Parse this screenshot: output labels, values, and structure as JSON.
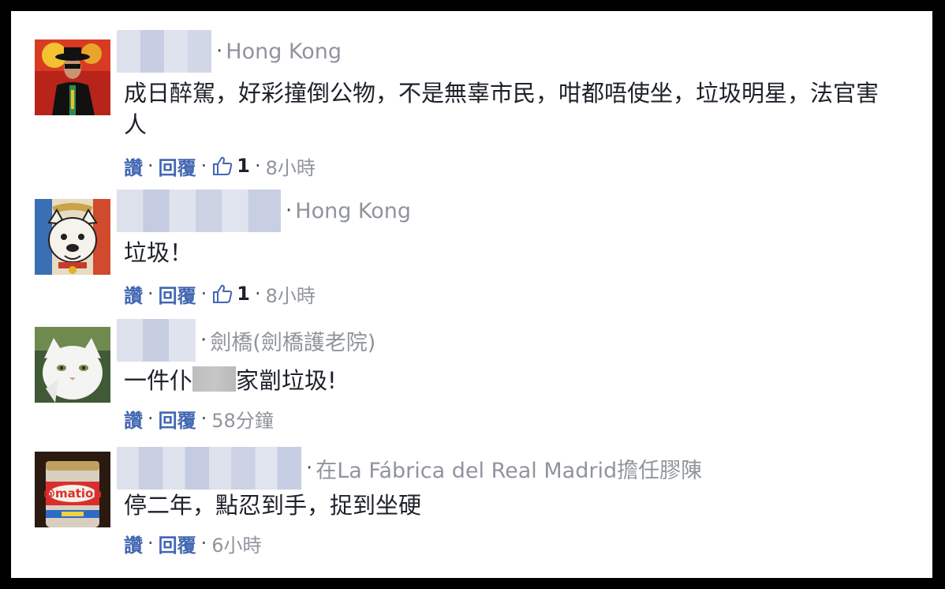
{
  "comments": [
    {
      "location": "Hong Kong",
      "text": "成日醉駕，好彩撞倒公物，不是無辜市民，咁都唔使坐，垃圾明星，法官害人",
      "like": "讚",
      "reply": "回覆",
      "likes": "1",
      "time": "8小時"
    },
    {
      "location": "Hong Kong",
      "text": "垃圾！",
      "like": "讚",
      "reply": "回覆",
      "likes": "1",
      "time": "8小時"
    },
    {
      "location": "劍橋(劍橋護老院)",
      "text_before": "一件仆",
      "text_after": "家劏垃圾!",
      "like": "讚",
      "reply": "回覆",
      "time": "58分鐘"
    },
    {
      "location": "在La Fábrica del Real Madrid擔任膠陳",
      "text": "停二年，點忍到手，捉到坐硬",
      "like": "讚",
      "reply": "回覆",
      "time": "6小時"
    }
  ],
  "colors": {
    "link": "#4267b2",
    "meta": "#90949c",
    "text": "#1d2129",
    "blur_light": "#dde1ec",
    "blur_dark": "#c5cbe0"
  },
  "icons": [
    "thumbs-up-icon"
  ]
}
